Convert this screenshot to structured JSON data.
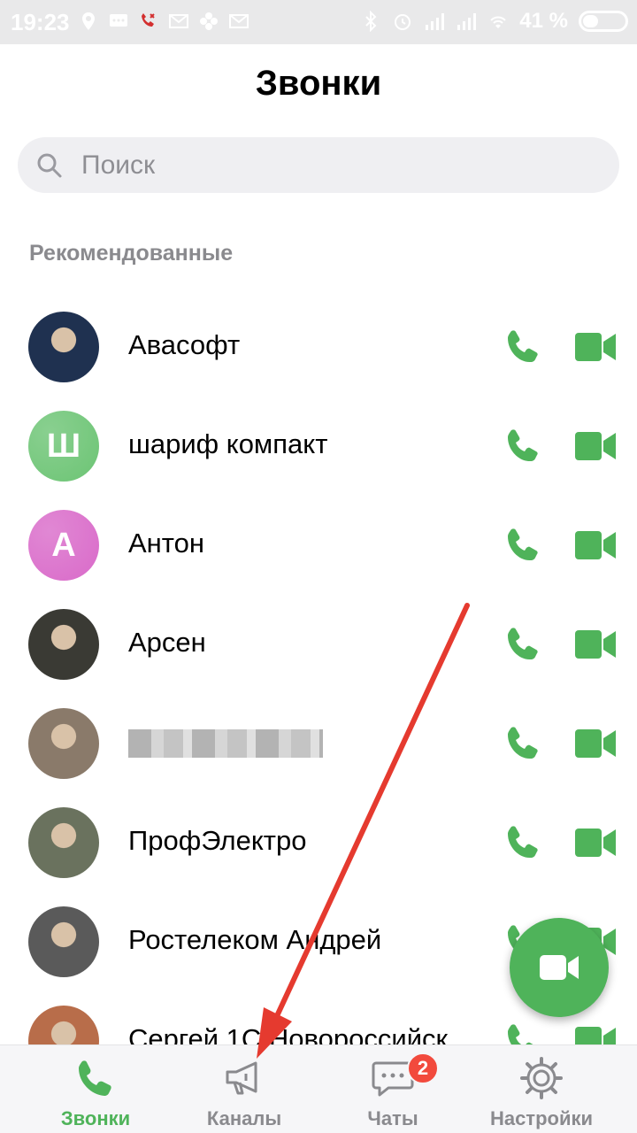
{
  "status_bar": {
    "time": "19:23",
    "battery_percent": "41 %",
    "battery_level": 0.41
  },
  "header": {
    "title": "Звонки"
  },
  "search": {
    "placeholder": "Поиск"
  },
  "section_label": "Рекомендованные",
  "contacts": [
    {
      "name": "Авасофт",
      "avatar_type": "photo",
      "avatar_color": "#1f3150"
    },
    {
      "name": "шариф компакт",
      "avatar_type": "letter",
      "avatar_letter": "Ш",
      "avatar_color": "#6cc474"
    },
    {
      "name": "Антон",
      "avatar_type": "letter",
      "avatar_letter": "А",
      "avatar_color": "#d96ac9"
    },
    {
      "name": "Арсен",
      "avatar_type": "photo",
      "avatar_color": "#3a3a34"
    },
    {
      "name": "",
      "avatar_type": "photo",
      "avatar_color": "#8a7a6a"
    },
    {
      "name": "ПрофЭлектро",
      "avatar_type": "photo",
      "avatar_color": "#6a725e"
    },
    {
      "name": "Ростелеком Андрей",
      "avatar_type": "photo",
      "avatar_color": "#5a5a5a"
    },
    {
      "name": "Сергей 1С Новороссийск",
      "avatar_type": "photo",
      "avatar_color": "#b86d4a"
    }
  ],
  "bottom_nav": {
    "items": [
      {
        "label": "Звонки",
        "icon": "phone-icon",
        "active": true
      },
      {
        "label": "Каналы",
        "icon": "megaphone-icon",
        "active": false
      },
      {
        "label": "Чаты",
        "icon": "chat-icon",
        "active": false,
        "badge": "2"
      },
      {
        "label": "Настройки",
        "icon": "gear-icon",
        "active": false
      }
    ]
  },
  "colors": {
    "accent": "#4fb35a",
    "badge": "#f24a3d",
    "annotation_arrow": "#e53a2f"
  }
}
